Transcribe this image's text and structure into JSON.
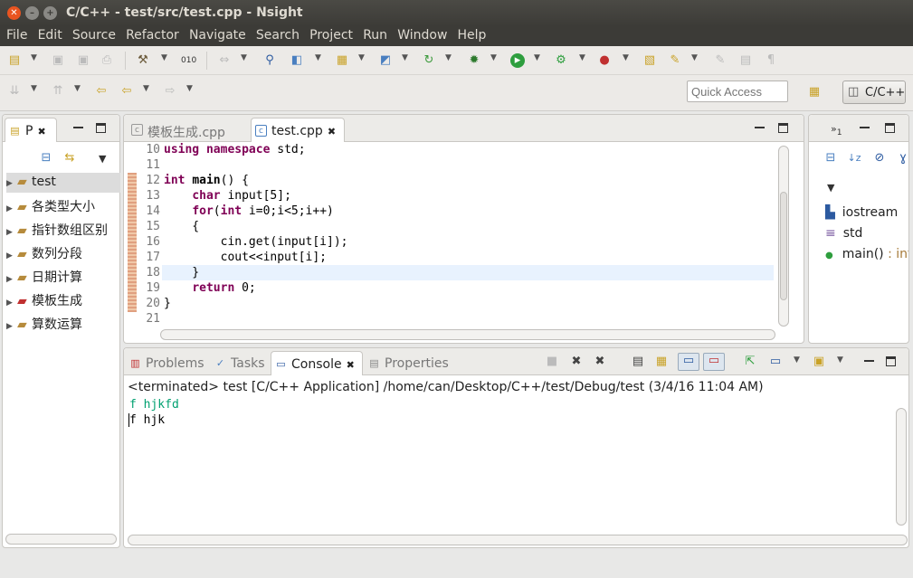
{
  "window": {
    "title": "C/C++ - test/src/test.cpp - Nsight",
    "close": "✕",
    "min": "–",
    "max": "+"
  },
  "menu": [
    "File",
    "Edit",
    "Source",
    "Refactor",
    "Navigate",
    "Search",
    "Project",
    "Run",
    "Window",
    "Help"
  ],
  "quick_access": {
    "placeholder": "Quick Access"
  },
  "perspective": {
    "label": "C/C++"
  },
  "project_explorer": {
    "tab_label": "P",
    "items": [
      {
        "label": "test",
        "selected": true
      },
      {
        "label": "各类型大小"
      },
      {
        "label": "指针数组区别"
      },
      {
        "label": "数列分段"
      },
      {
        "label": "日期计算"
      },
      {
        "label": "模板生成"
      },
      {
        "label": "算数运算"
      }
    ]
  },
  "editor": {
    "tabs": [
      {
        "label": "模板生成.cpp",
        "active": false
      },
      {
        "label": "test.cpp",
        "active": true
      }
    ],
    "lines": [
      {
        "no": "10",
        "html": "<span class='kw'>using</span> <span class='kw'>namespace</span> std;"
      },
      {
        "no": "11",
        "html": ""
      },
      {
        "no": "12",
        "html": "<span class='kw'>int</span> <b>main</b>() {"
      },
      {
        "no": "13",
        "html": "    <span class='kw'>char</span> input[5];"
      },
      {
        "no": "14",
        "html": "    <span class='kw'>for</span>(<span class='kw'>int</span> i=0;i&lt;5;i++)"
      },
      {
        "no": "15",
        "html": "    {"
      },
      {
        "no": "16",
        "html": "        cin.get(input[i]);"
      },
      {
        "no": "17",
        "html": "        cout&lt;&lt;input[i];"
      },
      {
        "no": "18",
        "html": "    }"
      },
      {
        "no": "19",
        "html": "    <span class='kw'>return</span> 0;"
      },
      {
        "no": "20",
        "html": "}"
      },
      {
        "no": "21",
        "html": ""
      }
    ]
  },
  "outline": {
    "items": [
      {
        "label": "iostream",
        "type": ""
      },
      {
        "label": "std",
        "type": ""
      },
      {
        "label": "main()",
        "type": " : int"
      }
    ]
  },
  "console": {
    "tabs": [
      "Problems",
      "Tasks",
      "Console",
      "Properties"
    ],
    "active_tab": "Console",
    "header": "<terminated> test [C/C++ Application] /home/can/Desktop/C++/test/Debug/test (3/4/16 11:04 AM)",
    "input_line": "f hjkfd",
    "output_line": "f hjk"
  },
  "colors": {
    "title_bg": "#3c3b37",
    "keyword": "#7f0055",
    "input": "#00a070",
    "close_btn": "#e95420"
  }
}
